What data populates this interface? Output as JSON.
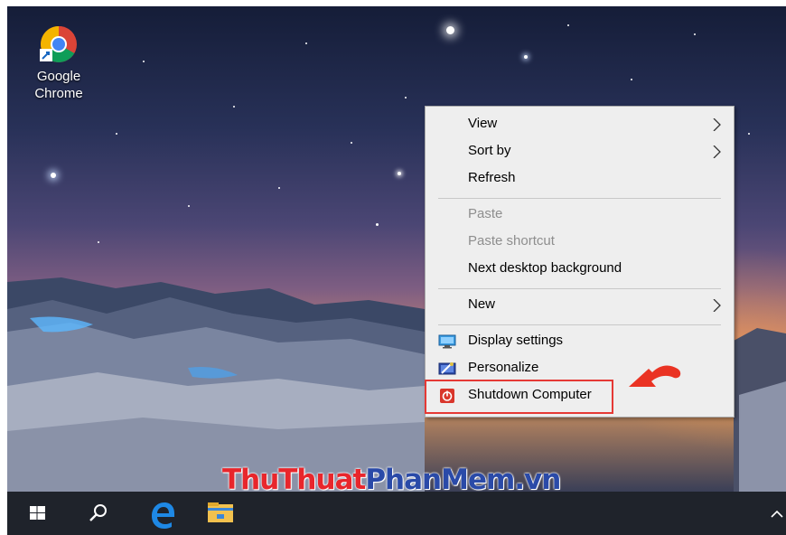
{
  "desktop": {
    "shortcut": {
      "label_line1": "Google",
      "label_line2": "Chrome",
      "icon": "chrome-icon"
    }
  },
  "context_menu": {
    "items": [
      {
        "label": "View",
        "submenu": true,
        "enabled": true
      },
      {
        "label": "Sort by",
        "submenu": true,
        "enabled": true
      },
      {
        "label": "Refresh",
        "submenu": false,
        "enabled": true
      },
      {
        "label": "Paste",
        "submenu": false,
        "enabled": false
      },
      {
        "label": "Paste shortcut",
        "submenu": false,
        "enabled": false
      },
      {
        "label": "Next desktop background",
        "submenu": false,
        "enabled": true
      },
      {
        "label": "New",
        "submenu": true,
        "enabled": true
      },
      {
        "label": "Display settings",
        "submenu": false,
        "enabled": true,
        "icon": "display-icon"
      },
      {
        "label": "Personalize",
        "submenu": false,
        "enabled": true,
        "icon": "personalize-icon"
      },
      {
        "label": "Shutdown Computer",
        "submenu": false,
        "enabled": true,
        "icon": "power-icon",
        "highlighted": true
      }
    ]
  },
  "watermark": {
    "part1": "ThuThuat",
    "part2": "PhanMem.vn"
  },
  "taskbar": {
    "icons": [
      "windows-start-icon",
      "search-icon",
      "edge-icon",
      "file-explorer-icon",
      "chevron-up-icon"
    ]
  },
  "colors": {
    "highlight": "#e53935",
    "menu_bg": "#eeeeee",
    "taskbar": "#1f232b"
  }
}
